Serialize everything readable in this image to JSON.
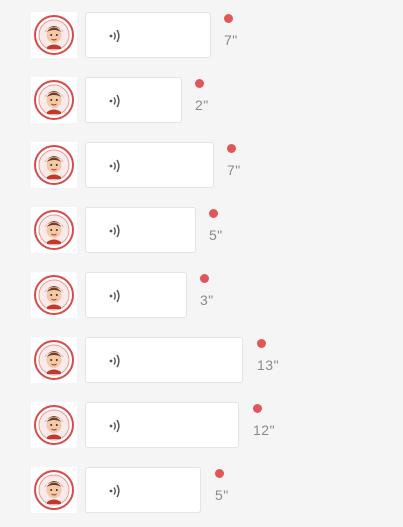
{
  "colors": {
    "background": "#f5f5f5",
    "bubble": "#ffffff",
    "unread_dot": "#e0575a",
    "duration_text": "#8a8a8a",
    "avatar_ring": "#d94a4a"
  },
  "messages": [
    {
      "type": "voice",
      "icon": "voice-wave-icon",
      "duration": "7\"",
      "unread": true
    },
    {
      "type": "voice",
      "icon": "voice-wave-icon",
      "duration": "2\"",
      "unread": true
    },
    {
      "type": "voice",
      "icon": "voice-wave-icon",
      "duration": "7\"",
      "unread": true
    },
    {
      "type": "voice",
      "icon": "voice-wave-icon",
      "duration": "5\"",
      "unread": true
    },
    {
      "type": "voice",
      "icon": "voice-wave-icon",
      "duration": "3\"",
      "unread": true
    },
    {
      "type": "voice",
      "icon": "voice-wave-icon",
      "duration": "13\"",
      "unread": true
    },
    {
      "type": "voice",
      "icon": "voice-wave-icon",
      "duration": "12\"",
      "unread": true
    },
    {
      "type": "voice",
      "icon": "voice-wave-icon",
      "duration": "5\"",
      "unread": true
    }
  ]
}
